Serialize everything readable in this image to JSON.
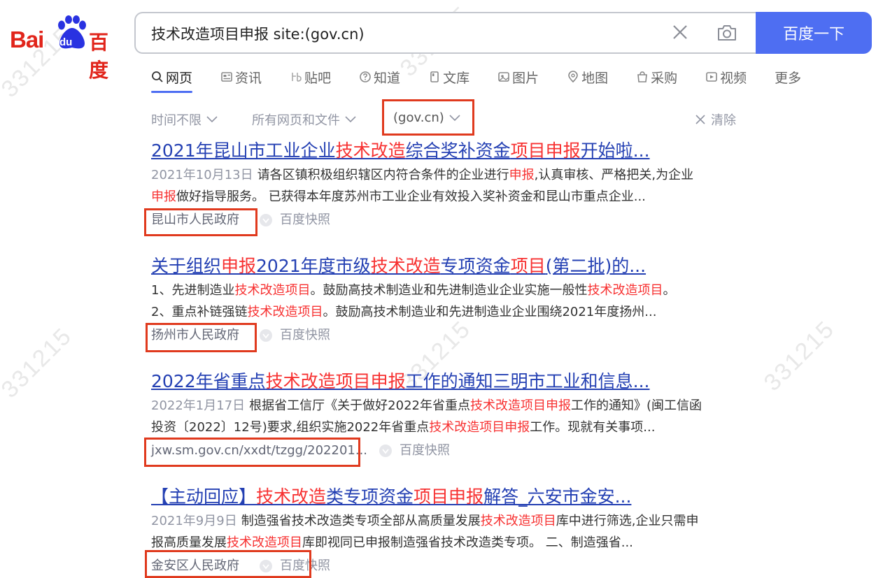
{
  "logo": {
    "bai": "Bai",
    "du": "du",
    "cn": "百度"
  },
  "search": {
    "query": "技术改造项目申报 site:(gov.cn)",
    "button": "百度一下"
  },
  "tabs": [
    {
      "label": "网页",
      "icon": "search-icon"
    },
    {
      "label": "资讯",
      "icon": "news-icon"
    },
    {
      "label": "贴吧",
      "icon": "tieba-icon"
    },
    {
      "label": "知道",
      "icon": "question-icon"
    },
    {
      "label": "文库",
      "icon": "document-icon"
    },
    {
      "label": "图片",
      "icon": "image-icon"
    },
    {
      "label": "地图",
      "icon": "map-pin-icon"
    },
    {
      "label": "采购",
      "icon": "shopping-icon"
    },
    {
      "label": "视频",
      "icon": "video-icon"
    },
    {
      "label": "更多",
      "icon": ""
    }
  ],
  "filters": {
    "time": "时间不限",
    "type": "所有网页和文件",
    "site": "(gov.cn)",
    "clear": "清除"
  },
  "watermark": "331215",
  "results": [
    {
      "title": [
        "2021年昆山市工业企业",
        "技术改造",
        "综合奖补资金",
        "项目申报",
        "开始啦..."
      ],
      "date": "2021年10月13日",
      "abstract_lines": [
        [
          "请各区镇积极组织辖区内符合条件的企业进行",
          "申报",
          ",认真审核、严格把关,为企业"
        ],
        [
          "申报",
          "做好指导服务。 已获得本年度苏州市工业企业有效投入奖补资金和昆山市重点企业..."
        ]
      ],
      "source": "昆山市人民政府",
      "snapshot": "百度快照"
    },
    {
      "title": [
        "关于组织",
        "申报",
        "2021年度市级",
        "技术改造",
        "专项资金",
        "项目",
        "(第二批)的..."
      ],
      "date": "",
      "abstract_lines": [
        [
          "1、先进制造业",
          "技术改造项目",
          "。鼓励高技术制造业和先进制造业企业实施一般性",
          "技术改造项目",
          "。"
        ],
        [
          "2、重点补链强链",
          "技术改造项目",
          "。鼓励高技术制造业和先进制造业企业围绕2021年度扬州..."
        ]
      ],
      "source": "扬州市人民政府",
      "snapshot": "百度快照"
    },
    {
      "title": [
        "2022年省重点",
        "技术改造项目申报",
        "工作的通知三明市工业和信息..."
      ],
      "date": "2022年1月17日",
      "abstract_lines": [
        [
          "根据省工信厅《关于做好2022年省重点",
          "技术改造项目申报",
          "工作的通知》(闽工信函"
        ],
        [
          "投资〔2022〕12号)要求,组织实施2022年省重点",
          "技术改造项目申报",
          "工作。现就有关事项..."
        ]
      ],
      "source": "jxw.sm.gov.cn/xxdt/tzgg/202201...",
      "snapshot": "百度快照"
    },
    {
      "title": [
        "【主动回应】",
        "技术改造",
        "类专项资金",
        "项目申报",
        "解答_六安市金安..."
      ],
      "date": "2021年9月9日",
      "abstract_lines": [
        [
          "制造强省技术改造类专项全部从高质量发展",
          "技术改造项目",
          "库中进行筛选,企业只需申"
        ],
        [
          "报高质量发展",
          "技术改造项目",
          "库即视同已申报制造强省技术改造类专项。 二、制造强省..."
        ]
      ],
      "source": "金安区人民政府",
      "snapshot": "百度快照"
    }
  ]
}
